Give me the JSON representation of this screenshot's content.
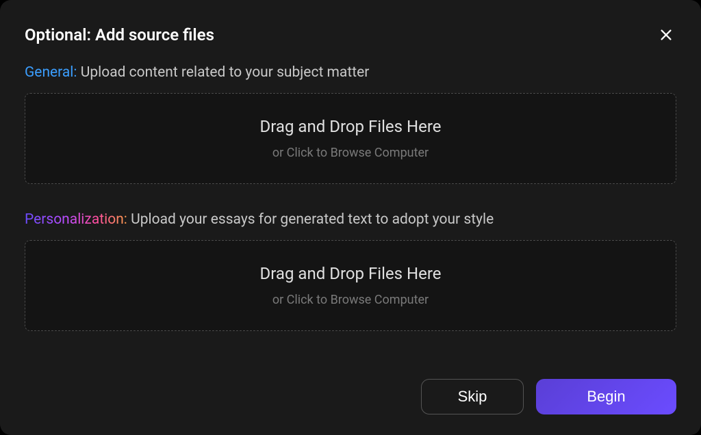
{
  "modal": {
    "title": "Optional: Add source files",
    "sections": {
      "general": {
        "label": "General:",
        "description": " Upload content related to your subject matter",
        "dropzone": {
          "title": "Drag and Drop Files Here",
          "subtitle": "or Click to Browse Computer"
        }
      },
      "personalization": {
        "label": "Personalization:",
        "description": "  Upload your essays for generated text to adopt your style",
        "dropzone": {
          "title": "Drag and Drop Files Here",
          "subtitle": "or Click to Browse Computer"
        }
      }
    },
    "buttons": {
      "skip": "Skip",
      "begin": "Begin"
    }
  }
}
